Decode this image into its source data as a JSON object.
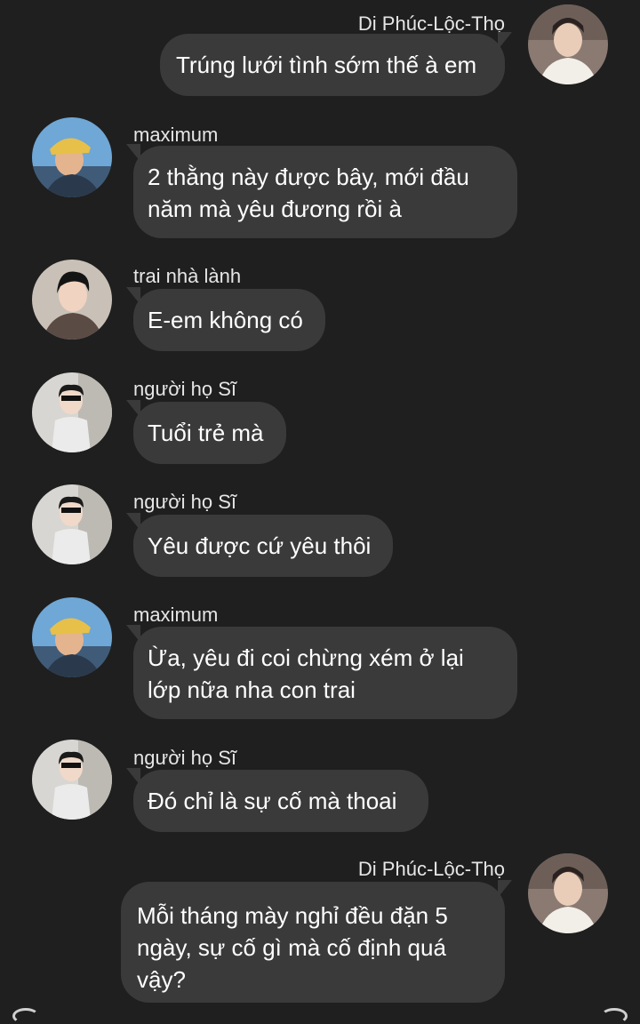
{
  "messages": [
    {
      "sender": "Di Phúc-Lộc-Thọ",
      "text": "Trúng lưới tình sớm thế à em",
      "direction": "outgoing",
      "avatar": "avatar-di-phuc-loc-tho"
    },
    {
      "sender": "maximum",
      "text": "2 thằng này được bây, mới đầu năm mà yêu đương rồi à",
      "direction": "incoming",
      "avatar": "avatar-maximum"
    },
    {
      "sender": "trai nhà lành",
      "text": "E-em không có",
      "direction": "incoming",
      "avatar": "avatar-trai-nha-lanh"
    },
    {
      "sender": "người họ Sĩ",
      "text": "Tuổi trẻ mà",
      "direction": "incoming",
      "avatar": "avatar-nguoi-ho-si"
    },
    {
      "sender": "người họ Sĩ",
      "text": "Yêu được cứ yêu thôi",
      "direction": "incoming",
      "avatar": "avatar-nguoi-ho-si"
    },
    {
      "sender": "maximum",
      "text": "Ừa, yêu đi coi chừng xém ở lại lớp nữa nha con trai",
      "direction": "incoming",
      "avatar": "avatar-maximum"
    },
    {
      "sender": "người họ Sĩ",
      "text": "Đó chỉ là sự cố mà thoai",
      "direction": "incoming",
      "avatar": "avatar-nguoi-ho-si"
    },
    {
      "sender": "Di Phúc-Lộc-Thọ",
      "text": "Mỗi tháng mày nghỉ đều đặn 5 ngày, sự cố gì mà cố định quá vậy?",
      "direction": "outgoing",
      "avatar": "avatar-di-phuc-loc-tho"
    }
  ],
  "colors": {
    "background": "#1f1f1f",
    "bubble": "#3a3a3a",
    "text": "#ffffff",
    "name": "#e6e6e6"
  }
}
